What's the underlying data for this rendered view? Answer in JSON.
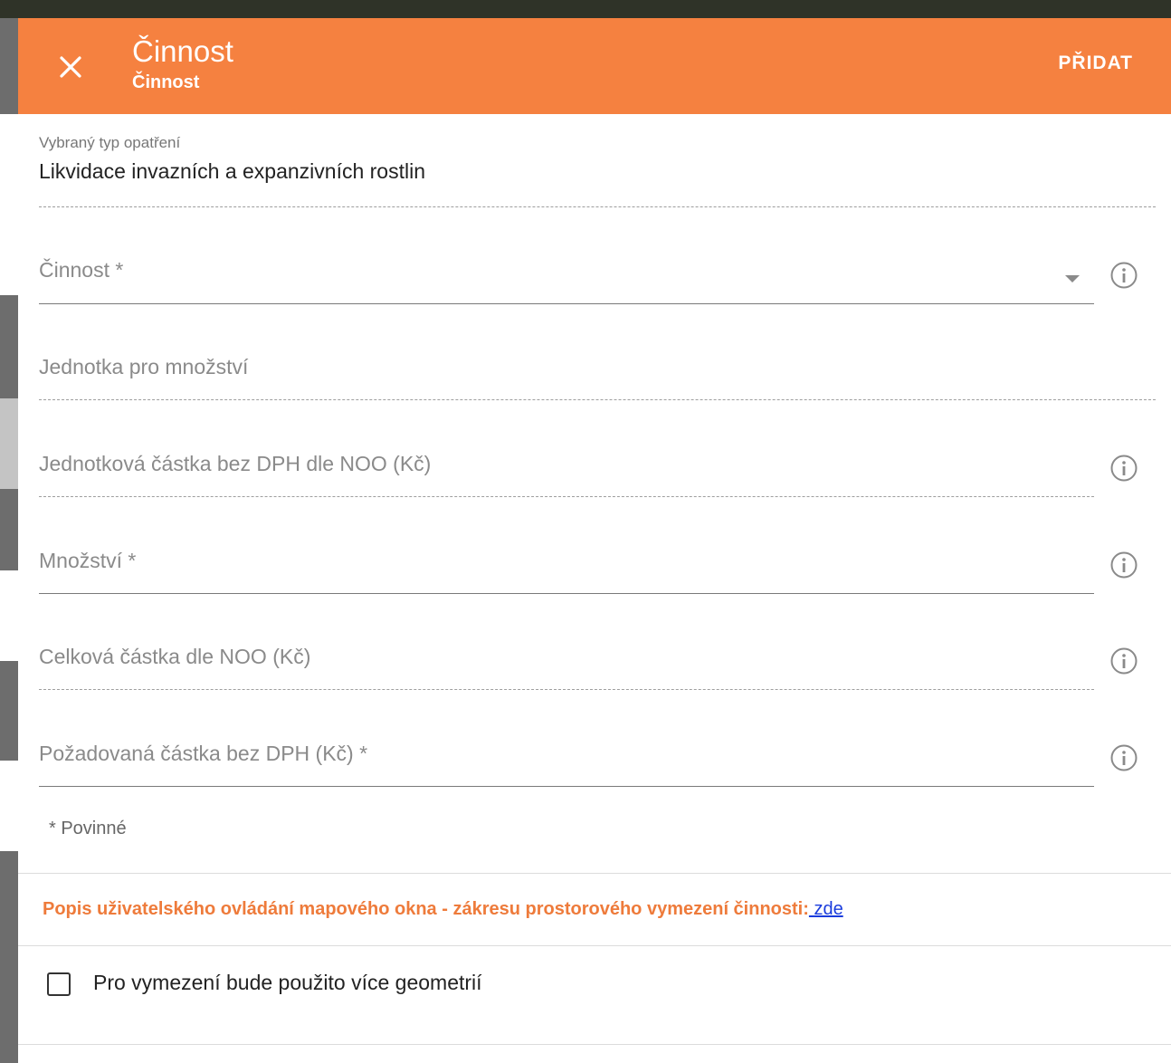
{
  "header": {
    "title": "Činnost",
    "subtitle": "Činnost",
    "add_label": "PŘIDAT",
    "background_color": "#f58140"
  },
  "form": {
    "selected_type": {
      "label": "Vybraný typ opatření",
      "value": "Likvidace invazních a expanzivních rostlin"
    },
    "activity": {
      "label": "Činnost *"
    },
    "unit": {
      "label": "Jednotka pro množství"
    },
    "unit_price": {
      "label": "Jednotková částka bez DPH dle NOO (Kč)"
    },
    "quantity": {
      "label": "Množství *"
    },
    "total": {
      "label": "Celková částka dle NOO (Kč)"
    },
    "requested": {
      "label": "Požadovaná částka bez DPH (Kč) *"
    },
    "required_note": "* Povinné"
  },
  "help": {
    "text": "Popis uživatelského ovládání mapového okna - zákresu prostorového vymezení činnosti:",
    "link_text": "zde",
    "text_color": "#ee7b3b"
  },
  "multi_geometry": {
    "label": "Pro vymezení bude použito více geometrií",
    "checked": false
  }
}
